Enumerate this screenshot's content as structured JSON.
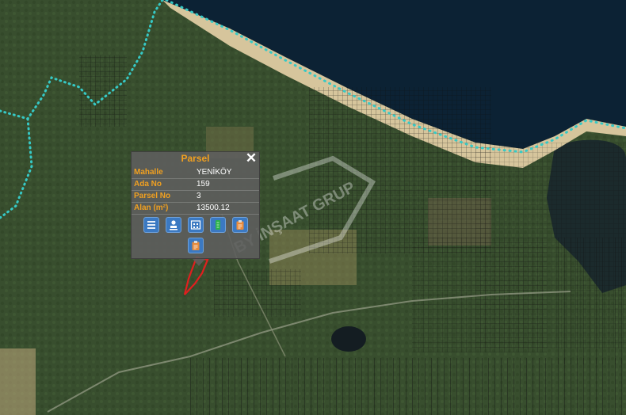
{
  "map": {
    "colors": {
      "sea": "#0c2234",
      "beach": "#d9c9a0",
      "land": "#3a4f2e",
      "boundary": "#36c9c6",
      "parcel": "#e01f1f",
      "grid": "#111111"
    }
  },
  "popup": {
    "title": "Parsel",
    "close_icon": "close-icon",
    "rows": [
      {
        "key": "Mahalle",
        "value": "YENİKÖY"
      },
      {
        "key": "Ada No",
        "value": "159"
      },
      {
        "key": "Parsel No",
        "value": "3"
      },
      {
        "key": "Alan (m²)",
        "value": "13500.12"
      }
    ],
    "tools": [
      {
        "icon": "list-icon"
      },
      {
        "icon": "person-stamp-icon"
      },
      {
        "icon": "building-map-icon"
      },
      {
        "icon": "green-document-icon"
      },
      {
        "icon": "clipboard-icon"
      },
      {
        "icon": "clipboard-icon"
      }
    ]
  },
  "watermark": {
    "text": "BY İNŞAAT GRUP"
  }
}
